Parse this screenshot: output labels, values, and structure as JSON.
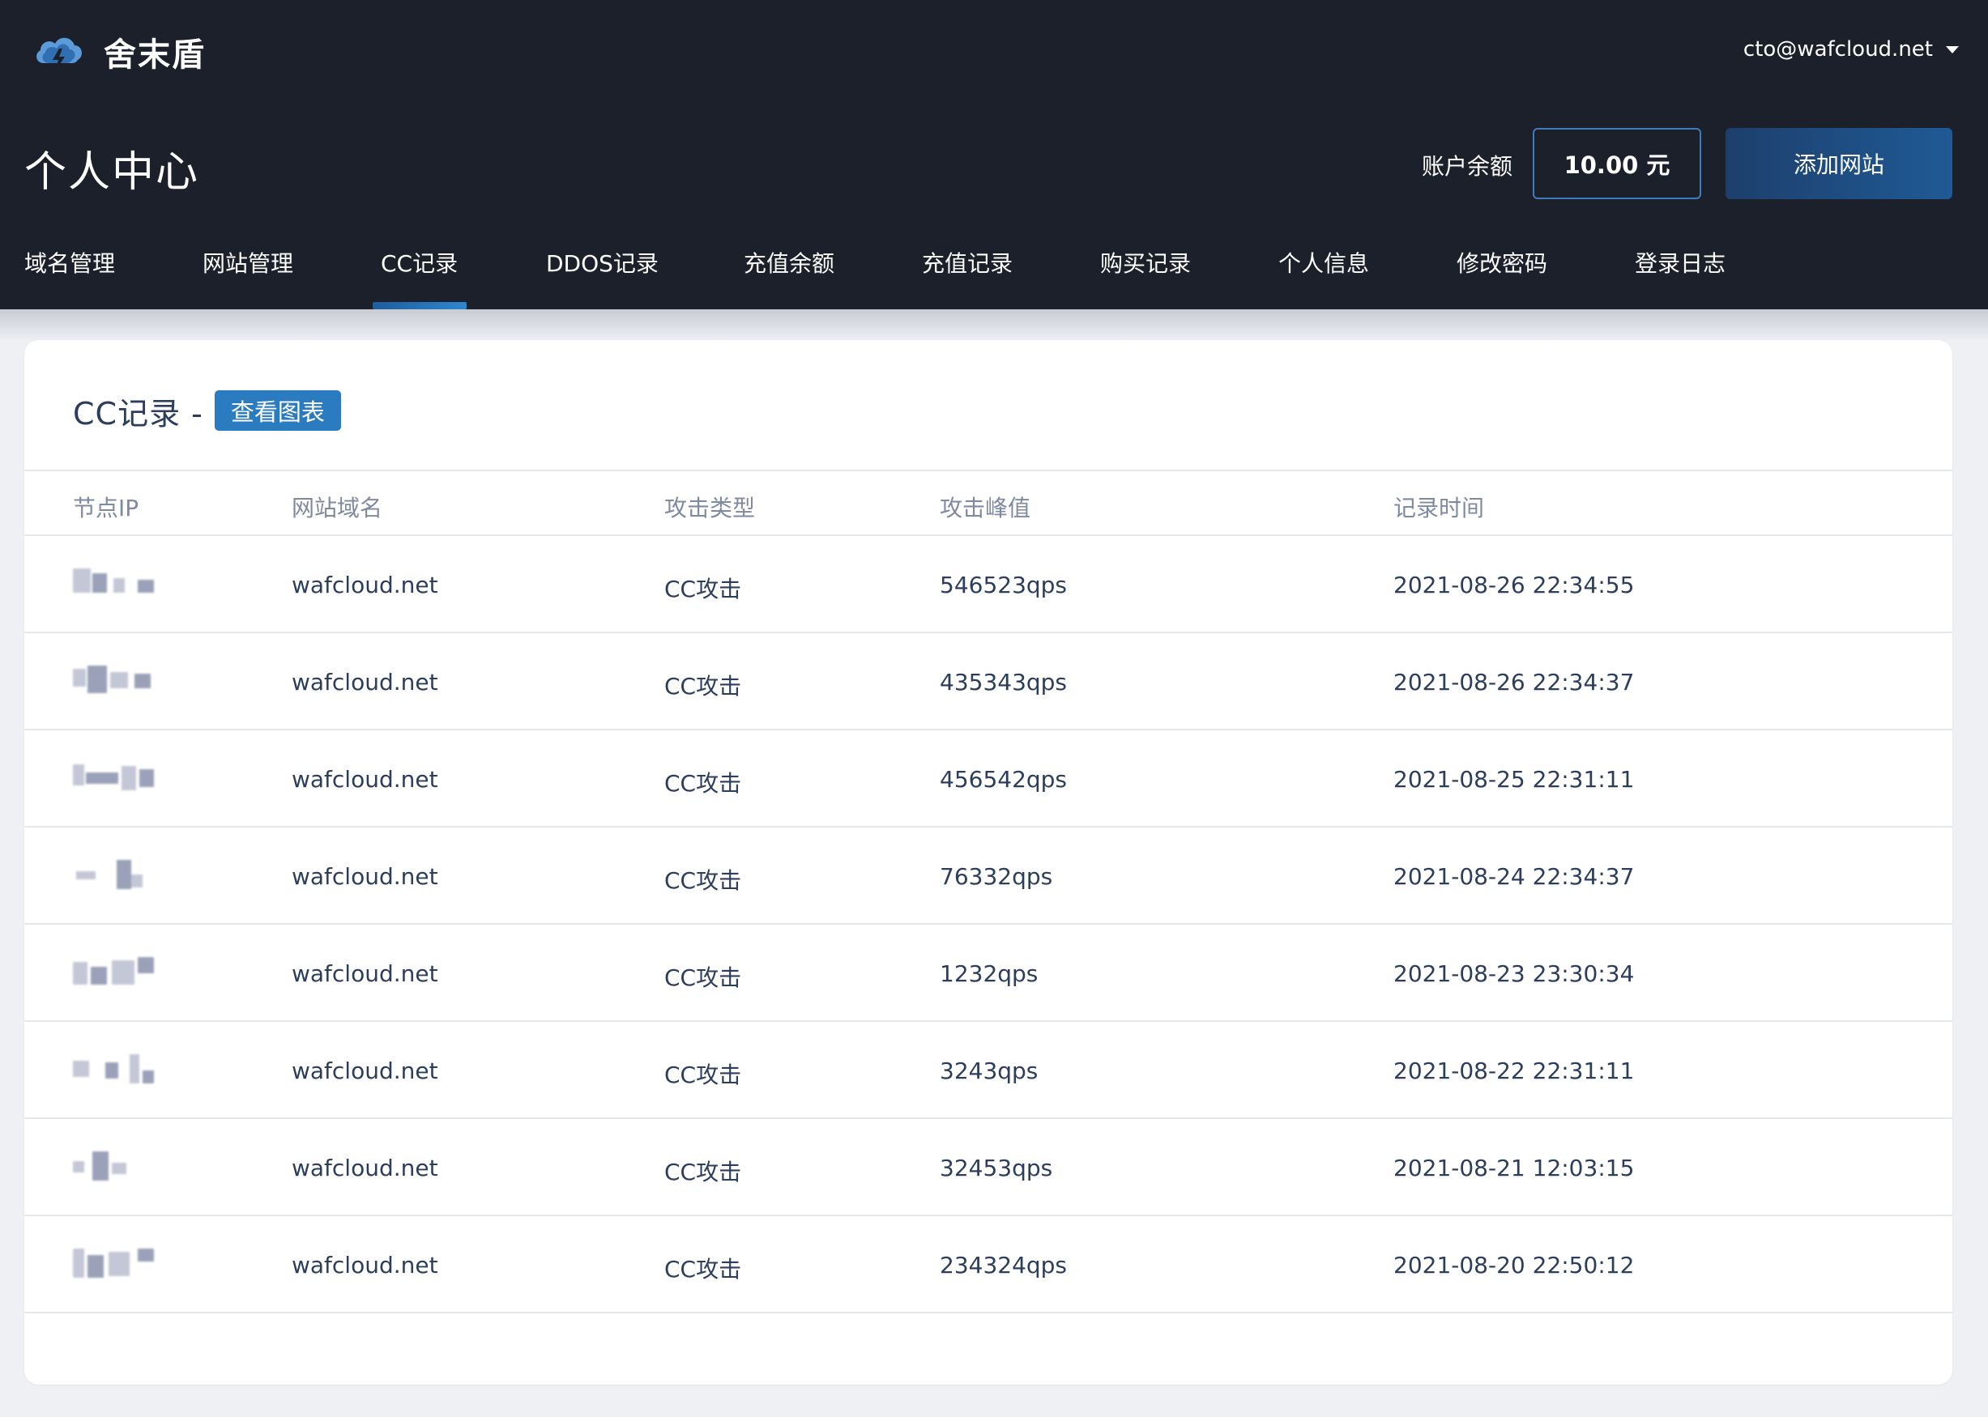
{
  "brand": {
    "name": "舍末盾",
    "logo_icon": "cloud-lightning-icon",
    "accent": "#2b7bc1"
  },
  "user": {
    "email": "cto@wafcloud.net"
  },
  "page_title": "个人中心",
  "balance": {
    "label": "账户余额",
    "value": "10.00 元"
  },
  "actions": {
    "add_site": "添加网站"
  },
  "nav": {
    "active": "CC记录",
    "items": [
      "域名管理",
      "网站管理",
      "CC记录",
      "DDOS记录",
      "充值余额",
      "充值记录",
      "购买记录",
      "个人信息",
      "修改密码",
      "登录日志"
    ]
  },
  "card": {
    "title": "CC记录 -",
    "chart_button": "查看图表"
  },
  "table": {
    "headers": [
      "节点IP",
      "网站域名",
      "攻击类型",
      "攻击峰值",
      "记录时间"
    ],
    "rows": [
      {
        "domain": "wafcloud.net",
        "type": "CC攻击",
        "peak": "546523qps",
        "time": "2021-08-26 22:34:55"
      },
      {
        "domain": "wafcloud.net",
        "type": "CC攻击",
        "peak": "435343qps",
        "time": "2021-08-26 22:34:37"
      },
      {
        "domain": "wafcloud.net",
        "type": "CC攻击",
        "peak": "456542qps",
        "time": "2021-08-25 22:31:11"
      },
      {
        "domain": "wafcloud.net",
        "type": "CC攻击",
        "peak": "76332qps",
        "time": "2021-08-24 22:34:37"
      },
      {
        "domain": "wafcloud.net",
        "type": "CC攻击",
        "peak": "1232qps",
        "time": "2021-08-23 23:30:34"
      },
      {
        "domain": "wafcloud.net",
        "type": "CC攻击",
        "peak": "3243qps",
        "time": "2021-08-22 22:31:11"
      },
      {
        "domain": "wafcloud.net",
        "type": "CC攻击",
        "peak": "32453qps",
        "time": "2021-08-21 12:03:15"
      },
      {
        "domain": "wafcloud.net",
        "type": "CC攻击",
        "peak": "234324qps",
        "time": "2021-08-20 22:50:12"
      }
    ]
  }
}
